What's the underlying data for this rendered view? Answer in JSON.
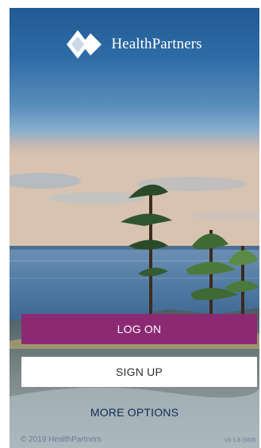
{
  "brand": {
    "name": "HealthPartners",
    "registered_mark": "®",
    "logo_icon": "healthpartners-diamond-logo",
    "accent_color": "#8b2a73"
  },
  "background": {
    "scene": "lake-sunset-with-pine-trees"
  },
  "actions": {
    "logon_label": "LOG ON",
    "signup_label": "SIGN UP",
    "more_options_label": "MORE OPTIONS"
  },
  "footer": {
    "copyright": "© 2019 HealthPartners",
    "version": "v3.1.8 (568)"
  }
}
